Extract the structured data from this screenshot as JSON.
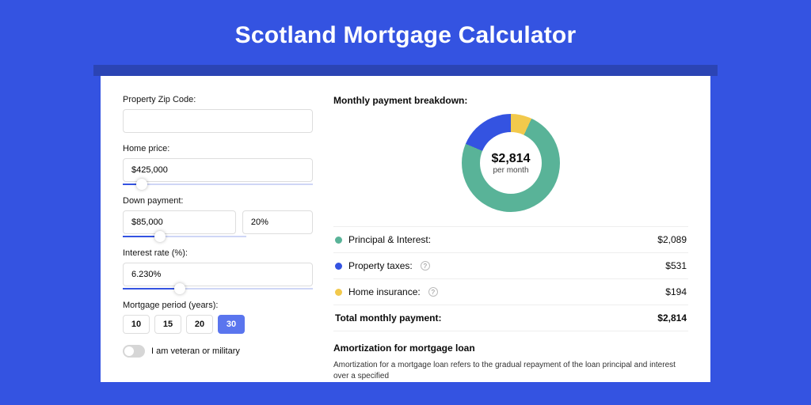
{
  "title": "Scotland Mortgage Calculator",
  "form": {
    "zip_label": "Property Zip Code:",
    "zip_value": "",
    "home_price_label": "Home price:",
    "home_price_value": "$425,000",
    "down_payment_label": "Down payment:",
    "down_payment_value": "$85,000",
    "down_payment_pct": "20%",
    "interest_label": "Interest rate (%):",
    "interest_value": "6.230%",
    "period_label": "Mortgage period (years):",
    "periods": [
      "10",
      "15",
      "20",
      "30"
    ],
    "period_selected": "30",
    "veteran_label": "I am veteran or military"
  },
  "breakdown": {
    "title": "Monthly payment breakdown:",
    "center_amount": "$2,814",
    "center_sub": "per month",
    "items": [
      {
        "label": "Principal & Interest:",
        "value": "$2,089",
        "color": "green",
        "info": false
      },
      {
        "label": "Property taxes:",
        "value": "$531",
        "color": "blue",
        "info": true
      },
      {
        "label": "Home insurance:",
        "value": "$194",
        "color": "yellow",
        "info": true
      }
    ],
    "total_label": "Total monthly payment:",
    "total_value": "$2,814"
  },
  "amortization": {
    "title": "Amortization for mortgage loan",
    "text": "Amortization for a mortgage loan refers to the gradual repayment of the loan principal and interest over a specified"
  },
  "chart_data": {
    "type": "pie",
    "title": "Monthly payment breakdown",
    "series": [
      {
        "name": "Principal & Interest",
        "value": 2089,
        "color": "#59b398"
      },
      {
        "name": "Property taxes",
        "value": 531,
        "color": "#3453e1"
      },
      {
        "name": "Home insurance",
        "value": 194,
        "color": "#f2c94c"
      }
    ],
    "center_label": "$2,814 per month",
    "total": 2814
  }
}
